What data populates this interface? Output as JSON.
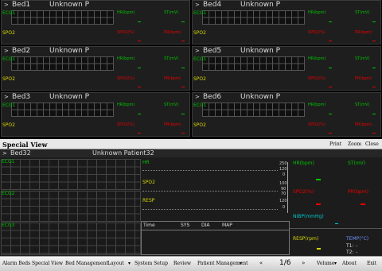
{
  "colors": {
    "ecg": "#00c400",
    "spo2": "#d8d800",
    "pr": "#e80000",
    "st": "#00c400",
    "resp": "#d8d800",
    "nibp": "#00c8c8",
    "temp": "#7090ff"
  },
  "beds": [
    {
      "name": "Bed1",
      "patient": "Unknown P",
      "ecg": "ECG1",
      "spo2": "SPO2",
      "hr": "HR(bpm)",
      "st": "ST(mV)",
      "spo2v": "SPO2(%)",
      "pr": "PR(bpm)"
    },
    {
      "name": "Bed4",
      "patient": "Unknown P",
      "ecg": "ECG1",
      "spo2": "SPO2",
      "hr": "HR(bpm)",
      "st": "ST(mV)",
      "spo2v": "SPO2(%)",
      "pr": "PR(bpm)"
    },
    {
      "name": "Bed2",
      "patient": "Unknown P",
      "ecg": "ECG1",
      "spo2": "SPO2",
      "hr": "HR(bpm)",
      "st": "ST(mV)",
      "spo2v": "SPO2(%)",
      "pr": "PR(bpm)"
    },
    {
      "name": "Bed5",
      "patient": "Unknown P",
      "ecg": "ECG1",
      "spo2": "SPO2",
      "hr": "HR(bpm)",
      "st": "ST(mV)",
      "spo2v": "SPO2(%)",
      "pr": "PR(bpm)"
    },
    {
      "name": "Bed3",
      "patient": "Unknown P",
      "ecg": "ECG1",
      "spo2": "SPO2",
      "hr": "HR(bpm)",
      "st": "ST(mV)",
      "spo2v": "SPO2(%)",
      "pr": "PR(bpm)"
    },
    {
      "name": "Bed6",
      "patient": "Unknown P",
      "ecg": "ECG1",
      "spo2": "SPO2",
      "hr": "HR(bpm)",
      "st": "ST(mV)",
      "spo2v": "SPO2(%)",
      "pr": "PR(bpm)"
    }
  ],
  "special": {
    "title": "Special View",
    "print": "Print",
    "zoom": "Zoom",
    "close": "Close",
    "bed": "Bed32",
    "patient": "Unknown Patient32",
    "ecg1": "ECG1",
    "ecg2": "ECG2",
    "ecg3": "ECG3",
    "hr": "HR",
    "spo2": "SPO2",
    "resp": "RESP",
    "scale_hr": [
      "250",
      "120",
      "0"
    ],
    "scale_spo2": [
      "100",
      "90",
      "70"
    ],
    "scale_resp": [
      "120",
      "0"
    ],
    "hr_label": "HR(bpm)",
    "st_label": "ST(mV)",
    "spo2_label": "SPO2(%)",
    "pr_label": "PR(bpm)",
    "nibp_label": "NIBP(mmHg)",
    "table": {
      "time": "Time",
      "sys": "SYS",
      "dia": "DIA",
      "map": "MAP"
    },
    "resp_label": "RESP(rpm)",
    "temp_label": "TEMP(°C)",
    "t1": "T1:",
    "t2": "T2:",
    "t1v": "-",
    "t2v": "-"
  },
  "toolbar": {
    "alarm": "Alarm Beds",
    "special": "Special View",
    "bed_mgmt": "Bed Management",
    "layout": "Layout",
    "sys_setup": "System Setup",
    "review": "Review",
    "patient_mgmt": "Patient Management",
    "page": "1/6",
    "volume": "Volume",
    "about": "About",
    "exit": "Exit"
  }
}
